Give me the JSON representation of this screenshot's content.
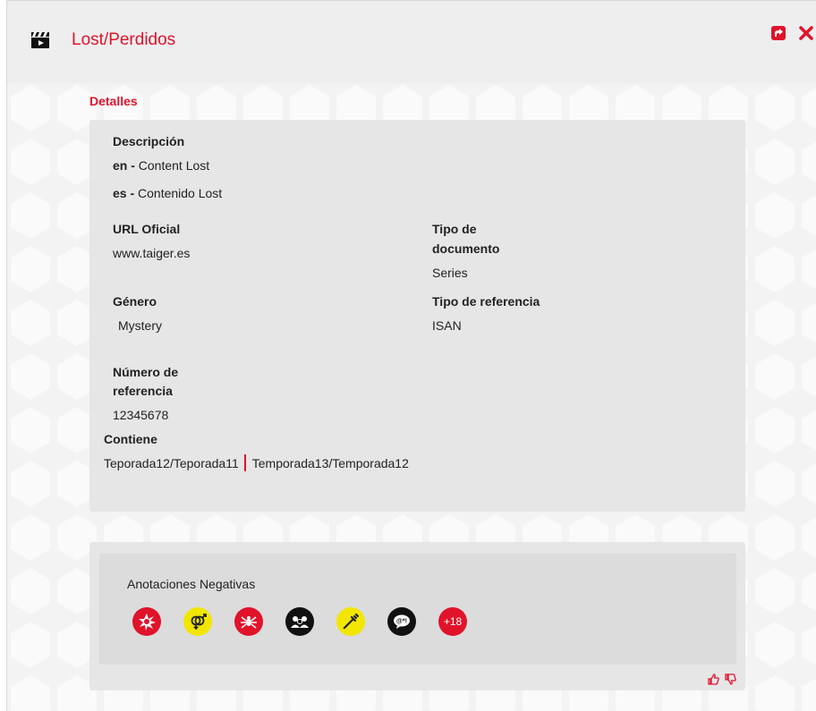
{
  "header": {
    "title": "Lost/Perdidos",
    "icon": "clapperboard-icon"
  },
  "colors": {
    "accent": "#e0132b",
    "yellow": "#f2e600",
    "black": "#111111"
  },
  "section": {
    "label": "Detalles"
  },
  "details": {
    "descripcion_label": "Descripción",
    "descripciones": [
      {
        "lang": "en -",
        "text": "Content Lost"
      },
      {
        "lang": "es -",
        "text": "Contenido Lost"
      }
    ],
    "url_label": "URL Oficial",
    "url_value": "www.taiger.es",
    "tipo_doc_label_1": "Tipo de",
    "tipo_doc_label_2": "documento",
    "tipo_doc_value": "Series",
    "genero_label": "Género",
    "genero_value": "Mystery",
    "tipo_ref_label": "Tipo de referencia",
    "tipo_ref_value": "ISAN",
    "numero_label_1": "Número de",
    "numero_label_2": "referencia",
    "numero_value": "12345678",
    "contiene_label": "Contiene",
    "contiene_items": [
      "Teporada12/Teporada11",
      "Temporada13/Temporada12"
    ]
  },
  "annotations": {
    "label": "Anotaciones Negativas",
    "icons": [
      {
        "name": "violence-icon",
        "color": "#e0132b"
      },
      {
        "name": "sex-icon",
        "color": "#f2e600"
      },
      {
        "name": "fear-spider-icon",
        "color": "#e0132b"
      },
      {
        "name": "discrimination-icon",
        "color": "#111111"
      },
      {
        "name": "drugs-icon",
        "color": "#f2e600"
      },
      {
        "name": "bad-language-icon",
        "color": "#111111"
      },
      {
        "name": "age-rating-icon",
        "color": "#e0132b",
        "text": "+18"
      }
    ]
  }
}
